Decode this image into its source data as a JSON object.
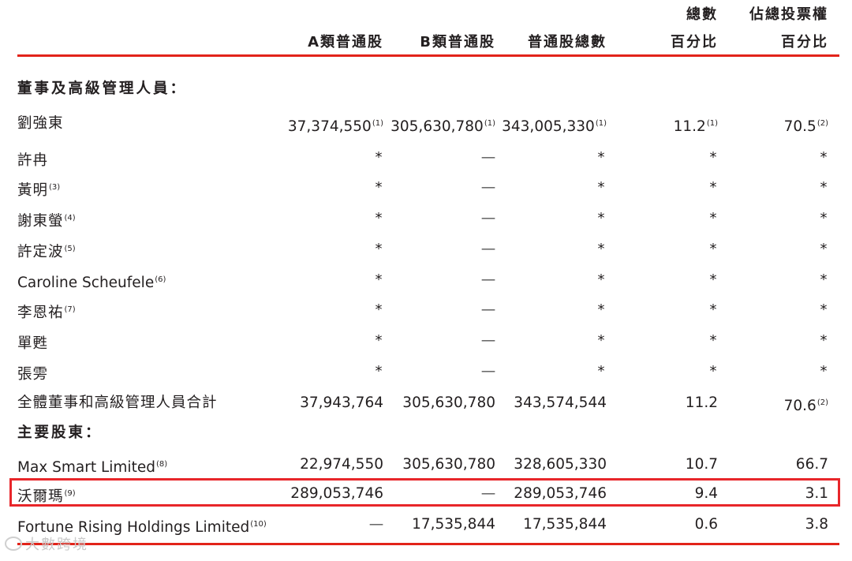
{
  "header": {
    "col_a": "A類普通股",
    "col_b": "B類普通股",
    "col_total": "普通股總數",
    "col_pct_line1": "總數",
    "col_pct_line2": "百分比",
    "col_vote_line1": "佔總投票權",
    "col_vote_line2": "百分比"
  },
  "sections": {
    "directors": "董事及高級管理人員：",
    "shareholders": "主要股東："
  },
  "rows": [
    {
      "name": "劉強東",
      "name_sup": "",
      "a": "37,374,550",
      "a_sup": "(1)",
      "b": "305,630,780",
      "b_sup": "(1)",
      "total": "343,005,330",
      "total_sup": "(1)",
      "pct": "11.2",
      "pct_sup": "(1)",
      "vote": "70.5",
      "vote_sup": "(2)"
    },
    {
      "name": "許冉",
      "name_sup": "",
      "a": "*",
      "b": "—",
      "total": "*",
      "pct": "*",
      "vote": "*"
    },
    {
      "name": "黃明",
      "name_sup": "(3)",
      "a": "*",
      "b": "—",
      "total": "*",
      "pct": "*",
      "vote": "*"
    },
    {
      "name": "謝東螢",
      "name_sup": "(4)",
      "a": "*",
      "b": "—",
      "total": "*",
      "pct": "*",
      "vote": "*"
    },
    {
      "name": "許定波",
      "name_sup": "(5)",
      "a": "*",
      "b": "—",
      "total": "*",
      "pct": "*",
      "vote": "*"
    },
    {
      "name": "Caroline Scheufele",
      "name_sup": "(6)",
      "a": "*",
      "b": "—",
      "total": "*",
      "pct": "*",
      "vote": "*"
    },
    {
      "name": "李恩祐",
      "name_sup": "(7)",
      "a": "*",
      "b": "—",
      "total": "*",
      "pct": "*",
      "vote": "*"
    },
    {
      "name": "單甦",
      "name_sup": "",
      "a": "*",
      "b": "—",
      "total": "*",
      "pct": "*",
      "vote": "*"
    },
    {
      "name": "張雱",
      "name_sup": "",
      "a": "*",
      "b": "—",
      "total": "*",
      "pct": "*",
      "vote": "*"
    },
    {
      "name": "全體董事和高級管理人員合計",
      "name_sup": "",
      "a": "37,943,764",
      "b": "305,630,780",
      "total": "343,574,544",
      "pct": "11.2",
      "vote": "70.6",
      "vote_sup": "(2)"
    },
    {
      "name": "Max Smart Limited",
      "name_sup": "(8)",
      "a": "22,974,550",
      "b": "305,630,780",
      "total": "328,605,330",
      "pct": "10.7",
      "vote": "66.7"
    },
    {
      "name": "沃爾瑪",
      "name_sup": "(9)",
      "a": "289,053,746",
      "b": "—",
      "total": "289,053,746",
      "pct": "9.4",
      "vote": "3.1"
    },
    {
      "name": "Fortune Rising Holdings Limited",
      "name_sup": "(10)",
      "a": "—",
      "b": "17,535,844",
      "total": "17,535,844",
      "pct": "0.6",
      "vote": "3.8"
    }
  ],
  "watermark": "大數跨境",
  "colors": {
    "rule": "#e2231a",
    "highlight": "#e8262a",
    "text": "#231f20"
  }
}
